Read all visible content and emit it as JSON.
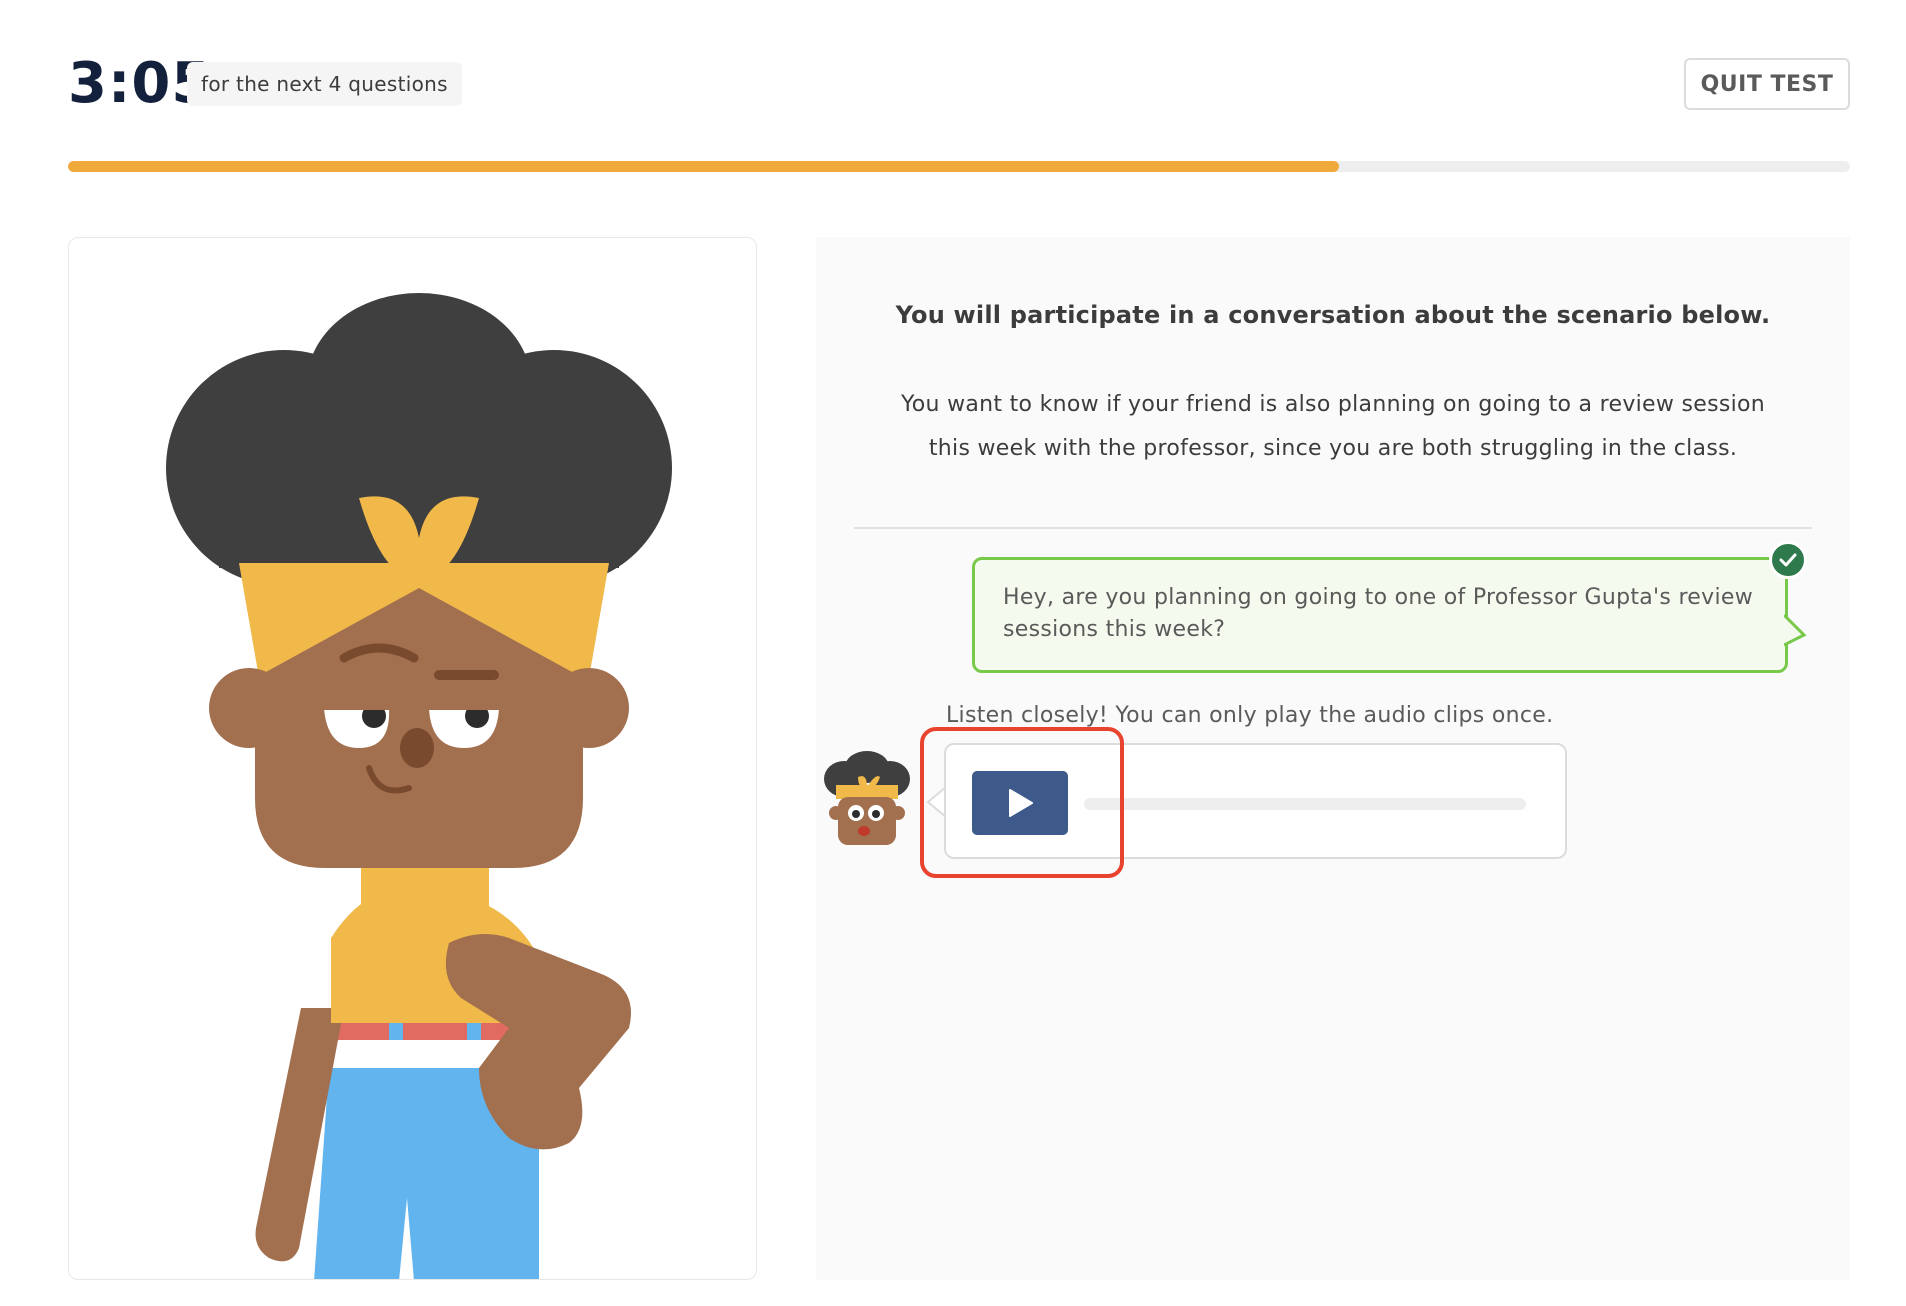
{
  "header": {
    "timer": "3:05",
    "timer_caption": "for the next 4 questions",
    "quit_label": "QUIT TEST"
  },
  "progress": {
    "fraction": 0.713,
    "fill_color": "#f0a93b"
  },
  "question": {
    "instruction": "You will participate in a conversation about the scenario below.",
    "scenario_line1": "You want to know if your friend is also planning on going to a review session",
    "scenario_line2": "this week with the professor, since you are both struggling in the class.",
    "user_message": "Hey, are you planning on going to one of Professor Gupta's review sessions this week?",
    "listen_note": "Listen closely! You can only play the audio clips once.",
    "audio_progress": 0.0
  },
  "icons": {
    "check": "check-icon",
    "play": "play-icon",
    "character": "character-illustration",
    "avatar": "character-avatar"
  },
  "colors": {
    "accent_green": "#78c84a",
    "check_green": "#2f7a4c",
    "play_blue": "#3d5a8a",
    "highlight_red": "#e8432e"
  }
}
